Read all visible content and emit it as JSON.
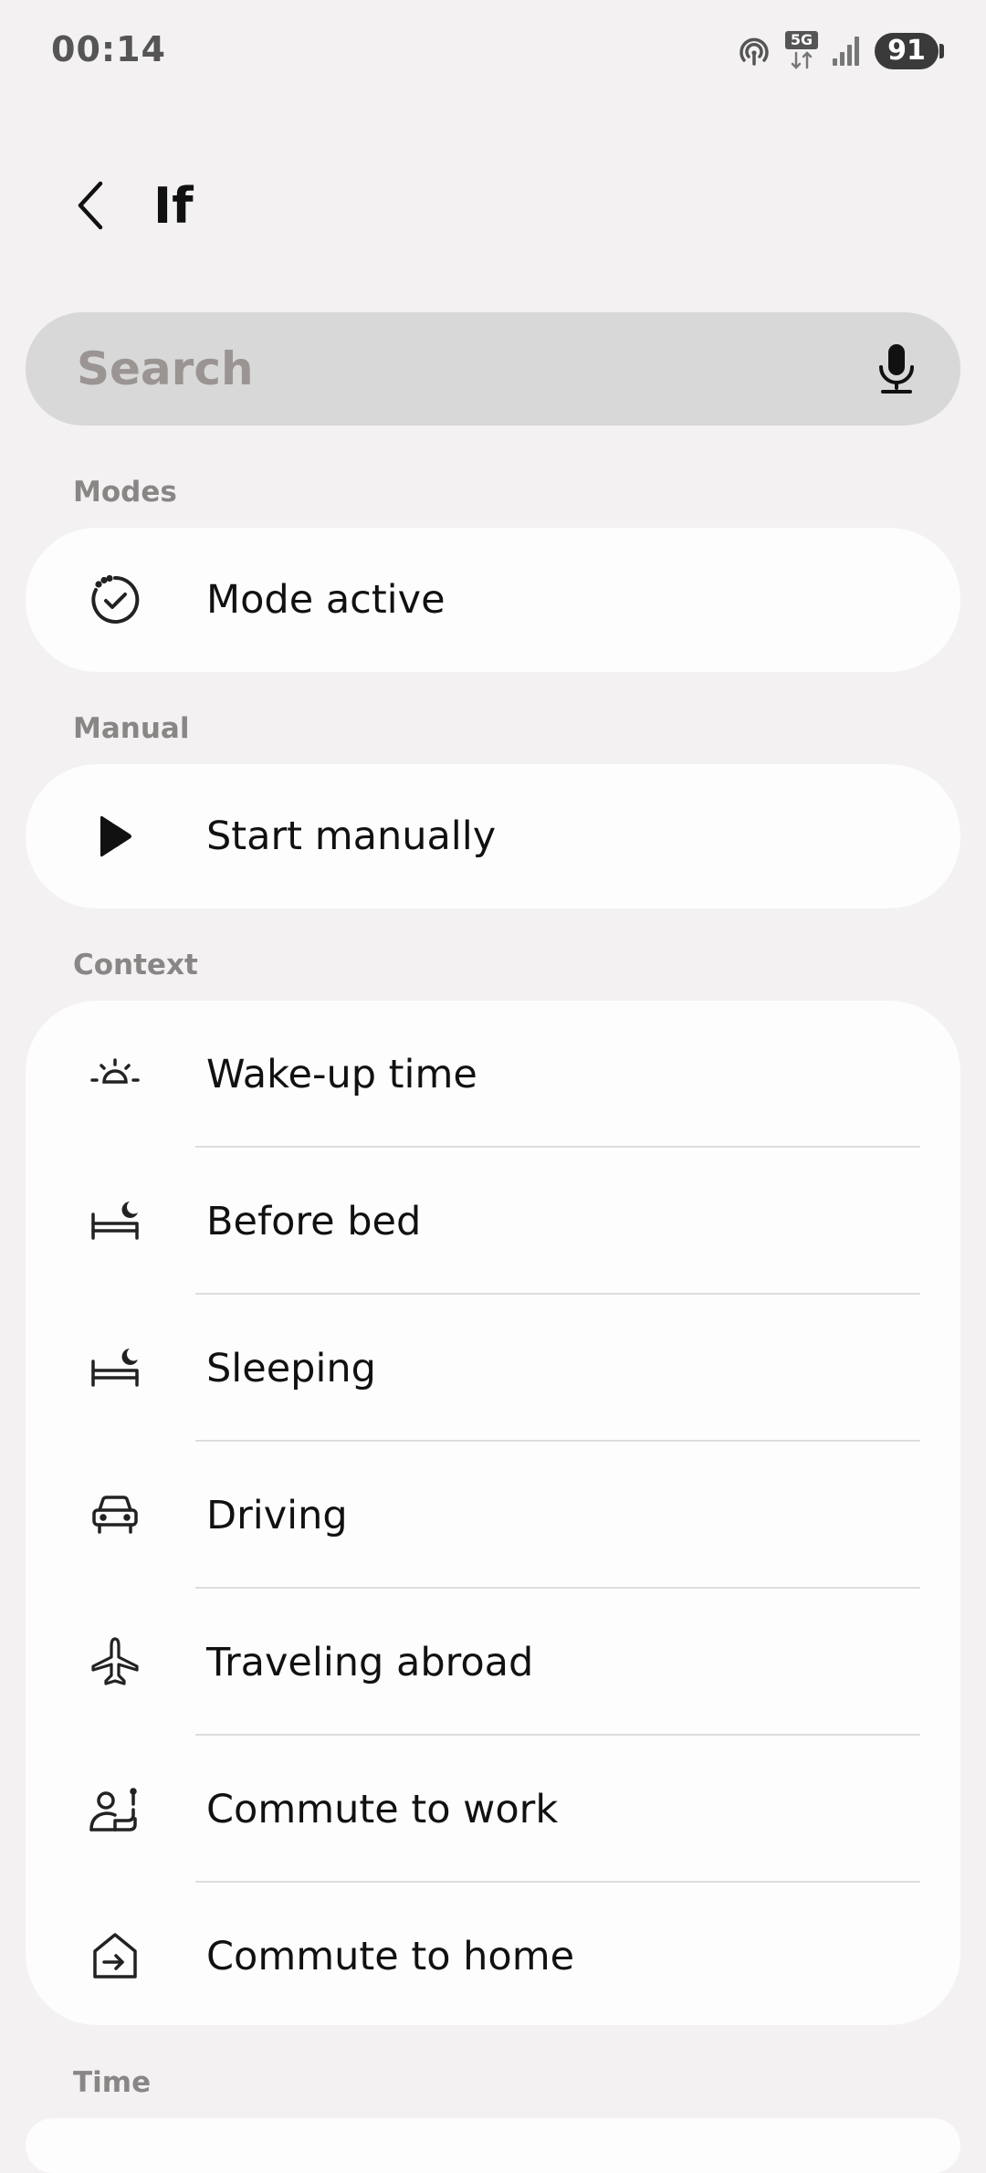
{
  "status_bar": {
    "time": "00:14",
    "network_label": "5G",
    "battery_level": "91",
    "icons": [
      "hotspot-icon",
      "network-5g-icon",
      "signal-icon",
      "battery-icon"
    ]
  },
  "header": {
    "title": "If",
    "back_icon": "chevron-left-icon"
  },
  "search": {
    "placeholder": "Search",
    "value": "",
    "mic_icon": "microphone-icon"
  },
  "sections": {
    "modes": {
      "header": "Modes",
      "items": [
        {
          "label": "Mode active",
          "icon": "mode-check-icon"
        }
      ]
    },
    "manual": {
      "header": "Manual",
      "items": [
        {
          "label": "Start manually",
          "icon": "play-icon"
        }
      ]
    },
    "context": {
      "header": "Context",
      "items": [
        {
          "label": "Wake-up time",
          "icon": "sunrise-icon"
        },
        {
          "label": "Before bed",
          "icon": "bed-moon-icon"
        },
        {
          "label": "Sleeping",
          "icon": "bed-moon-icon"
        },
        {
          "label": "Driving",
          "icon": "car-icon"
        },
        {
          "label": "Traveling abroad",
          "icon": "airplane-icon"
        },
        {
          "label": "Commute to work",
          "icon": "commute-work-icon"
        },
        {
          "label": "Commute to home",
          "icon": "commute-home-icon"
        }
      ]
    },
    "time": {
      "header": "Time"
    }
  },
  "colors": {
    "background": "#f3f1f2",
    "card": "#fdfdfd",
    "search_bg": "#d8d8d8",
    "section_header": "#8a8685",
    "text": "#111111"
  }
}
